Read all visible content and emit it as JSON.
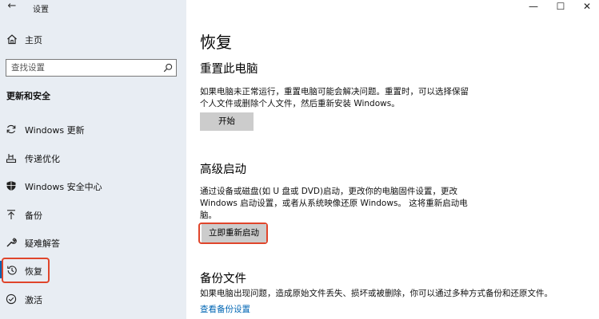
{
  "window": {
    "back_glyph": "←",
    "title": "设置",
    "minimize_glyph": "—",
    "maximize_glyph": "☐",
    "close_glyph": "✕"
  },
  "sidebar": {
    "home_label": "主页",
    "search_placeholder": "查找设置",
    "section_title": "更新和安全",
    "items": [
      {
        "label": "Windows 更新",
        "icon": "sync-icon"
      },
      {
        "label": "传递优化",
        "icon": "delivery-optimization-icon"
      },
      {
        "label": "Windows 安全中心",
        "icon": "shield-icon"
      },
      {
        "label": "备份",
        "icon": "backup-arrow-icon"
      },
      {
        "label": "疑难解答",
        "icon": "wrench-icon"
      },
      {
        "label": "恢复",
        "icon": "history-icon",
        "active": true
      },
      {
        "label": "激活",
        "icon": "check-circle-icon"
      }
    ]
  },
  "main": {
    "title": "恢复",
    "reset": {
      "heading": "重置此电脑",
      "desc_line1": "如果电脑未正常运行，重置电脑可能会解决问题。重置时，可以选择保留",
      "desc_line2": "个人文件或删除个人文件，然后重新安装 Windows。",
      "button": "开始"
    },
    "advanced": {
      "heading": "高级启动",
      "desc_line1": "通过设备或磁盘(如 U 盘或 DVD)启动，更改你的电脑固件设置，更改",
      "desc_line2": "Windows 启动设置，或者从系统映像还原 Windows。 这将重新启动电",
      "desc_line3": "脑。",
      "button": "立即重新启动"
    },
    "backup": {
      "heading": "备份文件",
      "desc": "如果电脑出现问题，造成原始文件丢失、损坏或被删除，你可以通过多种方式备份和还原文件。",
      "link": "查看备份设置"
    }
  },
  "colors": {
    "sidebar_bg": "#e8edf3",
    "accent": "#0063b1",
    "link": "#0066b4",
    "highlight": "#e0452b",
    "button_bg": "#cccccc"
  }
}
